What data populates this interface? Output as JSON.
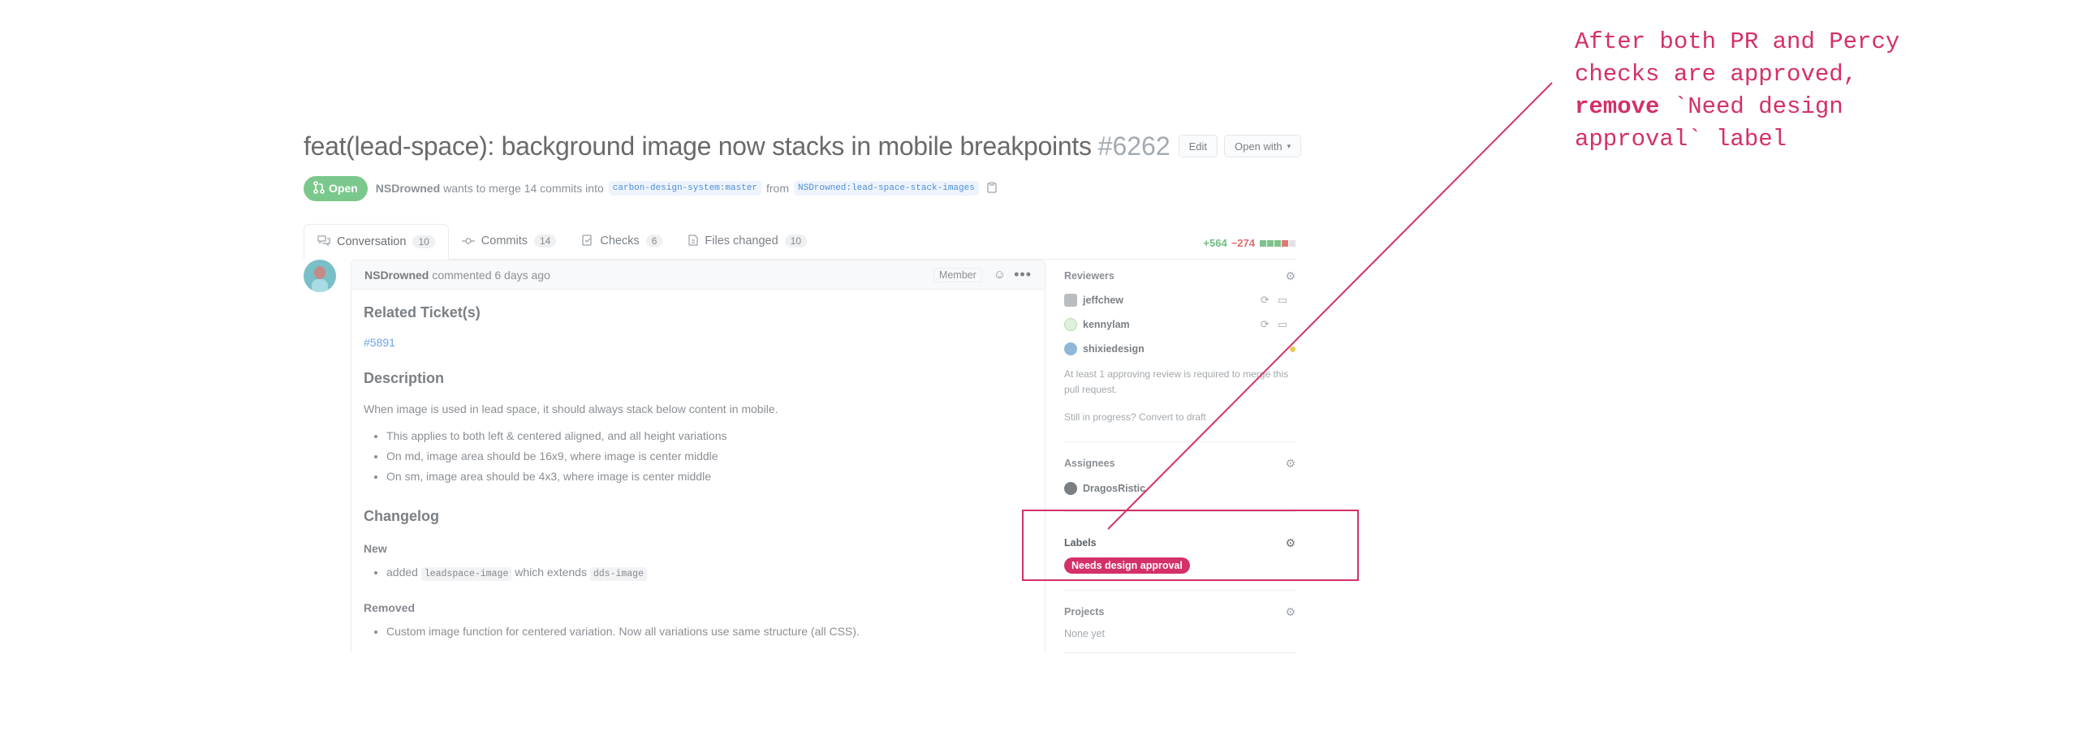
{
  "pr": {
    "title": "feat(lead-space): background image now stacks in mobile breakpoints",
    "number": "#6262",
    "edit_label": "Edit",
    "open_with_label": "Open with",
    "state": "Open",
    "author": "NSDrowned",
    "merge_text": "wants to merge 14 commits into",
    "base_branch": "carbon-design-system:master",
    "from_text": "from",
    "head_branch": "NSDrowned:lead-space-stack-images"
  },
  "tabs": [
    {
      "label": "Conversation",
      "count": "10"
    },
    {
      "label": "Commits",
      "count": "14"
    },
    {
      "label": "Checks",
      "count": "6"
    },
    {
      "label": "Files changed",
      "count": "10"
    }
  ],
  "diffstat": {
    "additions": "+564",
    "deletions": "−274"
  },
  "comment": {
    "author": "NSDrowned",
    "meta": "commented 6 days ago",
    "role": "Member",
    "h_ticket": "Related Ticket(s)",
    "ticket_link": "#5891",
    "h_description": "Description",
    "description": "When image is used in lead space, it should always stack below content in mobile.",
    "bullets": [
      "This applies to both left & centered aligned, and all height variations",
      "On md, image area should be 16x9, where image is center middle",
      "On sm, image area should be 4x3, where image is center middle"
    ],
    "h_changelog": "Changelog",
    "h_new": "New",
    "new_prefix": "added",
    "new_code1": "leadspace-image",
    "new_mid": "which extends",
    "new_code2": "dds-image",
    "h_removed": "Removed",
    "removed_item": "Custom image function for centered variation. Now all variations use same structure (all CSS)."
  },
  "sidebar": {
    "reviewers_title": "Reviewers",
    "reviewers": [
      {
        "name": "jeffchew"
      },
      {
        "name": "kennylam"
      },
      {
        "name": "shixiedesign"
      }
    ],
    "approval_note": "At least 1 approving review is required to merge this pull request.",
    "draft_note": "Still in progress? Convert to draft",
    "assignees_title": "Assignees",
    "assignee": "DragosRistic",
    "labels_title": "Labels",
    "label": "Needs design approval",
    "projects_title": "Projects",
    "projects_value": "None yet"
  },
  "annotation": {
    "line1": "After both PR and Percy",
    "line2": "checks are approved,",
    "bold": "remove",
    "line3_rest": " `Need design",
    "line4": "approval` label"
  },
  "colors": {
    "accent": "#d4306a",
    "open_green": "#7bc88c",
    "link_blue": "#6aa5e4",
    "diff_add": "#6fbc80",
    "diff_del": "#e06c6c"
  }
}
